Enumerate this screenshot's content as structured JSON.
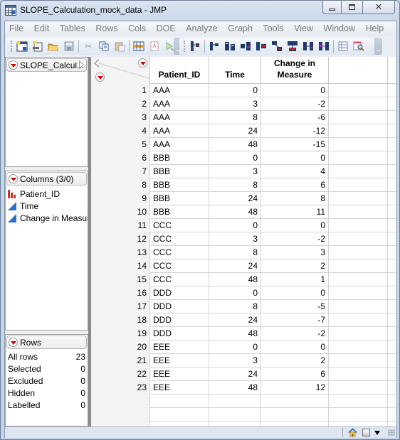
{
  "window": {
    "title": "SLOPE_Calculation_mock_data - JMP",
    "controls": {
      "minimize": "minimize",
      "maximize": "restore",
      "close": "close"
    }
  },
  "menu": [
    "File",
    "Edit",
    "Tables",
    "Rows",
    "Cols",
    "DOE",
    "Analyze",
    "Graph",
    "Tools",
    "View",
    "Window",
    "Help"
  ],
  "toolbar": {
    "file_group": [
      "new-data-table-icon",
      "new-script-icon",
      "open-folder-icon",
      "save-icon",
      "cut-icon",
      "copy-icon",
      "paste-icon",
      "data-grid-icon",
      "report-icon",
      "run-script-icon"
    ],
    "tables_group": [
      "summary-icon",
      "subset-icon",
      "sort-icon",
      "stack-icon",
      "split-icon",
      "transpose-icon",
      "concatenate-icon",
      "join-icon",
      "update-icon",
      "tabulate-icon",
      "query-builder-icon"
    ]
  },
  "table_panel": {
    "title": "SLOPE_Calcul..."
  },
  "columns_panel": {
    "title": "Columns (3/0)",
    "items": [
      {
        "name": "Patient_ID",
        "type": "nominal"
      },
      {
        "name": "Time",
        "type": "continuous"
      },
      {
        "name": "Change in Measure",
        "display": "Change in Measui",
        "type": "continuous"
      }
    ]
  },
  "rows_panel": {
    "title": "Rows",
    "stats": [
      {
        "label": "All rows",
        "value": "23"
      },
      {
        "label": "Selected",
        "value": "0"
      },
      {
        "label": "Excluded",
        "value": "0"
      },
      {
        "label": "Hidden",
        "value": "0"
      },
      {
        "label": "Labelled",
        "value": "0"
      }
    ]
  },
  "grid": {
    "headers": [
      "Patient_ID",
      "Time",
      "Change in Measure"
    ],
    "header_lines": [
      [
        "Patient_ID"
      ],
      [
        "Time"
      ],
      [
        "Change in",
        "Measure"
      ]
    ],
    "rows": [
      [
        "1",
        "AAA",
        "0",
        "0"
      ],
      [
        "2",
        "AAA",
        "3",
        "-2"
      ],
      [
        "3",
        "AAA",
        "8",
        "-6"
      ],
      [
        "4",
        "AAA",
        "24",
        "-12"
      ],
      [
        "5",
        "AAA",
        "48",
        "-15"
      ],
      [
        "6",
        "BBB",
        "0",
        "0"
      ],
      [
        "7",
        "BBB",
        "3",
        "4"
      ],
      [
        "8",
        "BBB",
        "8",
        "6"
      ],
      [
        "9",
        "BBB",
        "24",
        "8"
      ],
      [
        "10",
        "BBB",
        "48",
        "11"
      ],
      [
        "11",
        "CCC",
        "0",
        "0"
      ],
      [
        "12",
        "CCC",
        "3",
        "-2"
      ],
      [
        "13",
        "CCC",
        "8",
        "3"
      ],
      [
        "14",
        "CCC",
        "24",
        "2"
      ],
      [
        "15",
        "CCC",
        "48",
        "1"
      ],
      [
        "16",
        "DDD",
        "0",
        "0"
      ],
      [
        "17",
        "DDD",
        "8",
        "-5"
      ],
      [
        "18",
        "DDD",
        "24",
        "-7"
      ],
      [
        "19",
        "DDD",
        "48",
        "-2"
      ],
      [
        "20",
        "EEE",
        "0",
        "0"
      ],
      [
        "21",
        "EEE",
        "3",
        "2"
      ],
      [
        "22",
        "EEE",
        "24",
        "6"
      ],
      [
        "23",
        "EEE",
        "48",
        "12"
      ]
    ]
  },
  "statusbar": {
    "icons": [
      "home-icon",
      "checkbox-icon",
      "dropdown-arrow-icon"
    ]
  }
}
